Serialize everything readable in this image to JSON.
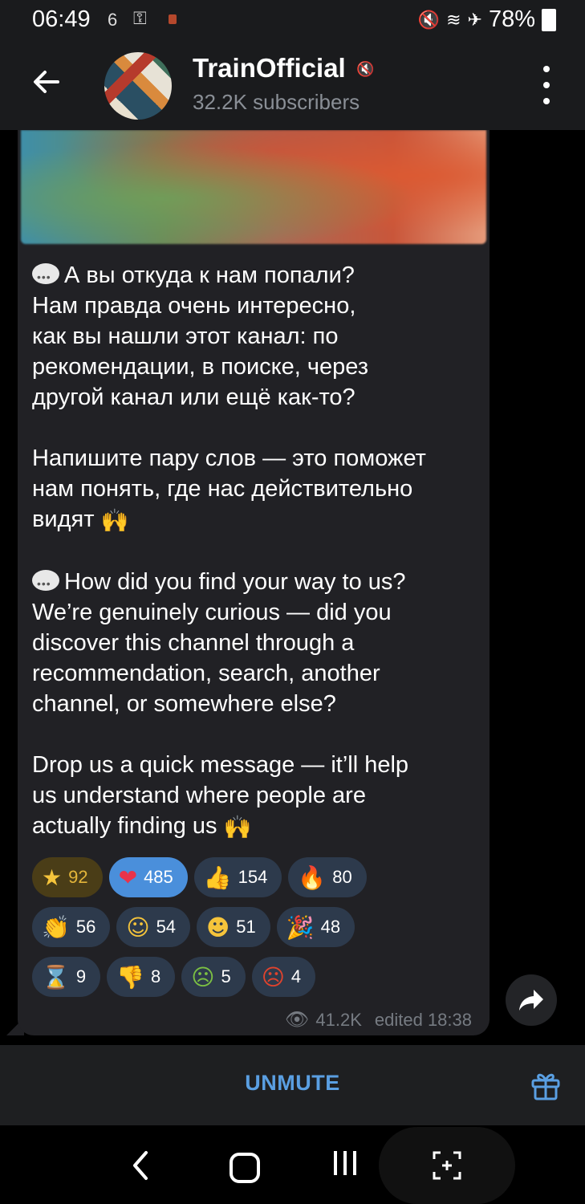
{
  "status_bar": {
    "time": "06:49",
    "notification_count": "6",
    "battery": "78%"
  },
  "header": {
    "channel_name": "TrainOfficial",
    "subscribers": "32.2K subscribers"
  },
  "message": {
    "ru_para1": "А вы откуда к нам попали?\nНам правда очень интересно,\nкак вы нашли этот канал: по\nрекомендации, в поиске, через\nдругой канал или ещё как-то?",
    "ru_para2": "Напишите пару слов — это поможет\nнам понять, где нас действительно\nвидят",
    "en_para1": "How did you find your way to us?\nWe’re genuinely curious — did you\ndiscover this channel through a\nrecommendation, search, another\nchannel, or somewhere else?",
    "en_para2": "Drop us a quick message — it’ll help\nus understand where people are\nactually finding us",
    "views": "41.2K",
    "edited": "edited 18:38"
  },
  "reactions": [
    [
      {
        "icon": "star",
        "glyph": "★",
        "count": "92"
      },
      {
        "icon": "heart",
        "glyph": "❤",
        "count": "485"
      },
      {
        "icon": "thumbs-up",
        "glyph": "👍",
        "count": "154"
      },
      {
        "icon": "fire",
        "glyph": "🔥",
        "count": "80"
      }
    ],
    [
      {
        "icon": "clap",
        "glyph": "👏",
        "count": "56"
      },
      {
        "icon": "smiling-hearts",
        "glyph": "☺",
        "count": "54"
      },
      {
        "icon": "star-struck",
        "glyph": "☻",
        "count": "51"
      },
      {
        "icon": "party-popper",
        "glyph": "🎉",
        "count": "48"
      }
    ],
    [
      {
        "icon": "hourglass",
        "glyph": "⌛",
        "count": "9"
      },
      {
        "icon": "thumbs-down",
        "glyph": "👎",
        "count": "8"
      },
      {
        "icon": "nauseated",
        "glyph": "☹",
        "count": "5"
      },
      {
        "icon": "cursing",
        "glyph": "☹",
        "count": "4"
      }
    ]
  ],
  "bottom": {
    "unmute_label": "UNMUTE"
  },
  "icons": {
    "speech_bubble": "speech-bubble-icon",
    "raised_hands": "🙌"
  },
  "colors": {
    "accent": "#5a9fe2",
    "active_reaction": "#4a8fdb",
    "bubble": "#212125"
  }
}
